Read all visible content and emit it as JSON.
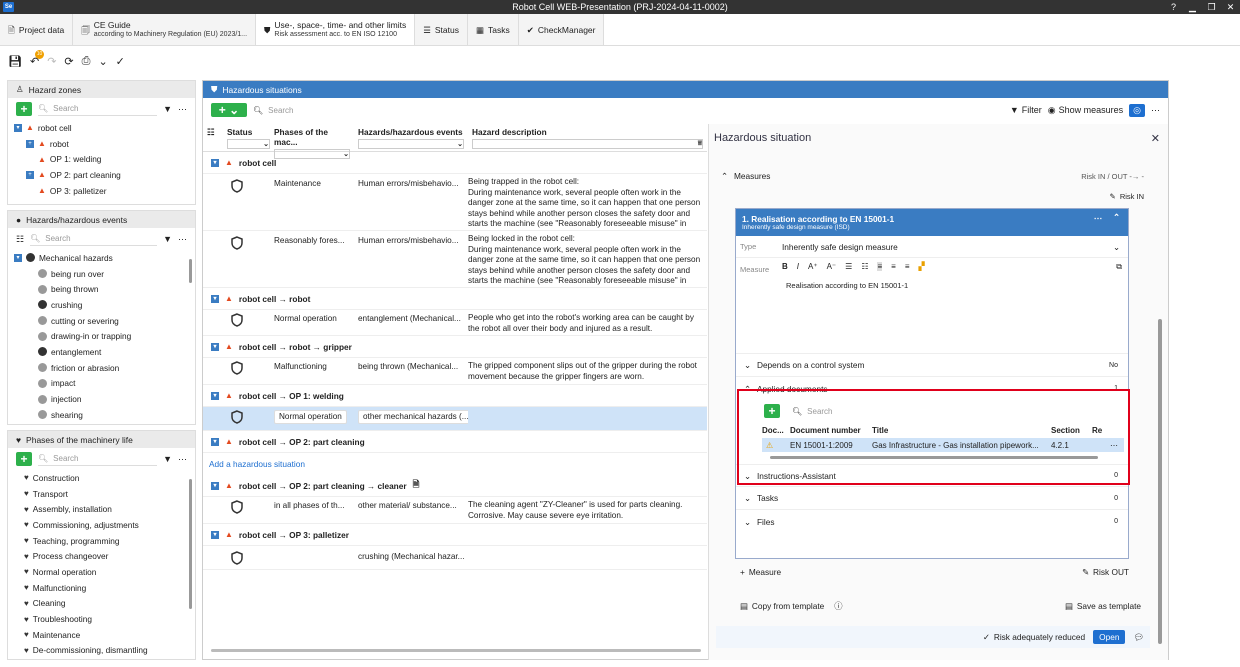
{
  "window": {
    "title": "Robot Cell WEB-Presentation (PRJ-2024-04-11-0002)",
    "app_icon": "Se"
  },
  "tabs": [
    {
      "label": "Project data",
      "sub": ""
    },
    {
      "label": "CE Guide",
      "sub": "according to Machinery Regulation (EU) 2023/1..."
    },
    {
      "label": "Use-, space-, time- and other limits",
      "sub": "Risk assessment acc. to EN ISO 12100"
    },
    {
      "label": "Status",
      "sub": ""
    },
    {
      "label": "Tasks",
      "sub": ""
    },
    {
      "label": "CheckManager",
      "sub": ""
    }
  ],
  "toolbar": {
    "badge": "10"
  },
  "hazard_zones": {
    "title": "Hazard zones",
    "search_placeholder": "Search",
    "items": [
      {
        "label": "robot cell"
      },
      {
        "label": "robot"
      },
      {
        "label": "OP 1: welding"
      },
      {
        "label": "OP 2: part cleaning"
      },
      {
        "label": "OP 3: palletizer"
      }
    ]
  },
  "hazards": {
    "title": "Hazards/hazardous events",
    "search_placeholder": "Search",
    "group": "Mechanical hazards",
    "items": [
      "being run over",
      "being thrown",
      "crushing",
      "cutting or severing",
      "drawing-in or trapping",
      "entanglement",
      "friction or abrasion",
      "impact",
      "injection",
      "shearing"
    ]
  },
  "phases": {
    "title": "Phases of the machinery life",
    "search_placeholder": "Search",
    "items": [
      "Construction",
      "Transport",
      "Assembly,  installation",
      "Commissioning, adjustments",
      "Teaching, programming",
      "Process changeover",
      "Normal operation",
      "Malfunctioning",
      "Cleaning",
      "Troubleshooting",
      "Maintenance",
      "De-commissioning, dismantling"
    ]
  },
  "situations": {
    "title": "Hazardous situations",
    "search_placeholder": "Search",
    "filter_label": "Filter",
    "show_measures_label": "Show measures",
    "columns": [
      "Status",
      "Phases of the mac...",
      "Hazards/hazardous events",
      "Hazard description"
    ],
    "groups": [
      {
        "title": "robot cell",
        "rows": [
          {
            "phase": "Maintenance",
            "hazard": "Human errors/misbehavio...",
            "desc": "Being trapped in the robot cell:\nDuring maintenance work, several people often work in the danger zone at the same time, so it can happen that one person stays behind while another person closes the safety door and starts the machine (see \"Reasonably foreseeable misuse\" in the..."
          },
          {
            "phase": "Reasonably fores...",
            "hazard": "Human errors/misbehavio...",
            "desc": "Being locked in the robot cell:\nDuring maintenance work, several people often work in the danger zone at the same time, so it can happen that one person stays behind while another person closes the safety door and starts the machine (see \"Reasonably foreseeable misuse\" in the..."
          }
        ]
      },
      {
        "title": "robot cell → robot",
        "rows": [
          {
            "phase": "Normal operation",
            "hazard": "entanglement (Mechanical...",
            "desc": "People who get into the robot's working area can be caught by the robot all over their body and injured as a result."
          }
        ]
      },
      {
        "title": "robot cell → robot → gripper",
        "rows": [
          {
            "phase": "Malfunctioning",
            "hazard": "being thrown (Mechanical...",
            "desc": "The gripped component slips out of the gripper during the robot movement because the gripper fingers are worn."
          }
        ]
      },
      {
        "title": "robot cell → OP 1: welding",
        "rows": [
          {
            "phase": "Normal operation",
            "hazard": "other mechanical hazards (...",
            "desc": ""
          }
        ]
      },
      {
        "title": "robot cell → OP 2: part cleaning",
        "rows": []
      },
      {
        "title": "robot cell → OP 2: part cleaning → cleaner",
        "rows": [
          {
            "phase": "in all phases of th...",
            "hazard": "other material/ substance...",
            "desc": "The cleaning agent \"ZY-Cleaner\" is used for parts cleaning. Corrosive. May cause severe eye irritation."
          }
        ]
      },
      {
        "title": "robot cell → OP 3: palletizer",
        "rows": [
          {
            "phase": "",
            "hazard": "crushing (Mechanical hazar...",
            "desc": ""
          }
        ]
      }
    ],
    "add_link": "Add a hazardous situation"
  },
  "detail": {
    "title": "Hazardous situation",
    "measures_label": "Measures",
    "risk_in_out": "Risk IN / OUT -→ -",
    "risk_in": "Risk IN",
    "card": {
      "title": "1. Realisation according to EN 15001-1",
      "subtitle": "Inherently safe design measure (ISD)",
      "type_label": "Type",
      "type_value": "Inherently safe design measure",
      "measure_label": "Measure",
      "measure_text": "Realisation according to EN 15001-1",
      "depends_label": "Depends on a control system",
      "depends_value": "No",
      "applied_label": "Applied documents",
      "applied_count": "1",
      "doc_search_placeholder": "Search",
      "doc_columns": [
        "Doc...",
        "Document number",
        "Title",
        "Section",
        "Re"
      ],
      "doc_row": {
        "number": "EN 15001-1:2009",
        "title": "Gas Infrastructure - Gas installation pipework...",
        "section": "4.2.1"
      },
      "sections": [
        {
          "label": "Instructions-Assistant",
          "count": "0"
        },
        {
          "label": "Tasks",
          "count": "0"
        },
        {
          "label": "Files",
          "count": "0"
        }
      ]
    },
    "add_measure": "Measure",
    "risk_out": "Risk OUT",
    "copy_template": "Copy from template",
    "save_template": "Save as template",
    "risk_reduced": "Risk adequately reduced",
    "status_button": "Open"
  }
}
